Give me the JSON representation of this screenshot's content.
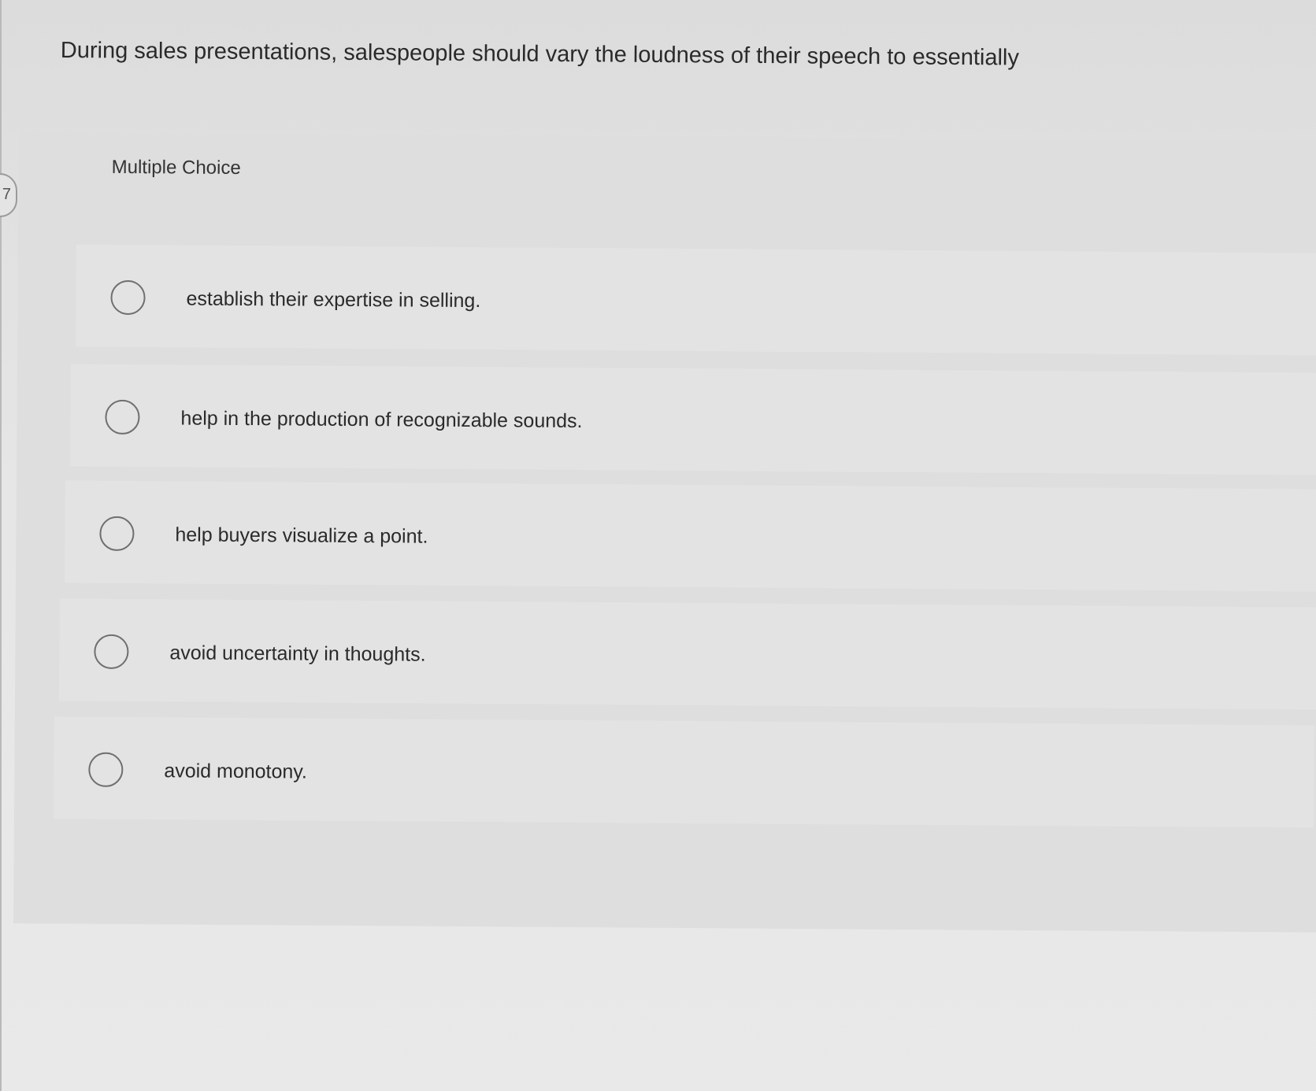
{
  "question": {
    "text": "During sales presentations, salespeople should vary the loudness of their speech to essentially"
  },
  "panel": {
    "type_label": "Multiple Choice"
  },
  "side_tab": {
    "glyph": "7"
  },
  "options": [
    {
      "label": "establish their expertise in selling.",
      "selected": false
    },
    {
      "label": "help in the production of recognizable sounds.",
      "selected": false
    },
    {
      "label": "help buyers visualize a point.",
      "selected": false
    },
    {
      "label": "avoid uncertainty in thoughts.",
      "selected": false
    },
    {
      "label": "avoid monotony.",
      "selected": false
    }
  ],
  "colors": {
    "background": "#e6e6e6",
    "panel": "#dedede",
    "text": "#2a2a2a",
    "radio_border": "#6f6f6f"
  }
}
